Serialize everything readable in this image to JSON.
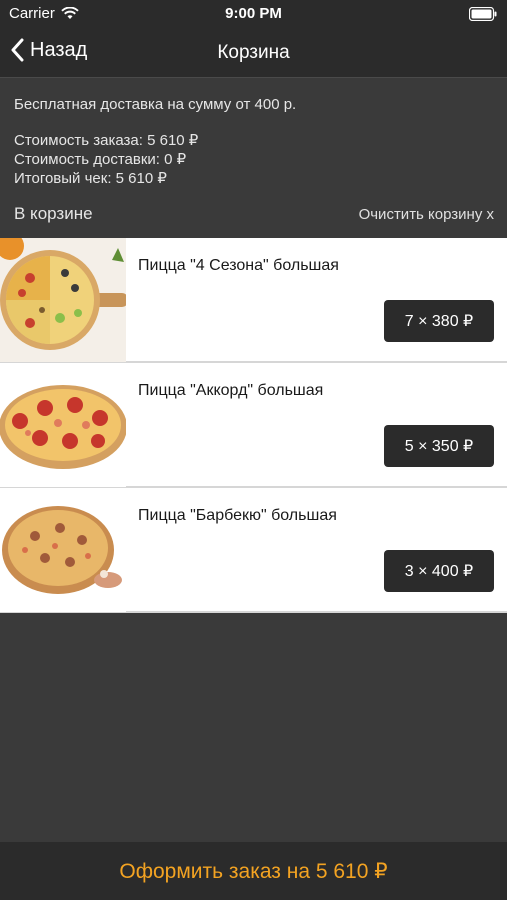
{
  "status_bar": {
    "carrier": "Carrier",
    "time": "9:00 PM"
  },
  "nav": {
    "back_label": "Назад",
    "title": "Корзина"
  },
  "info": {
    "free_delivery": "Бесплатная доставка на сумму от 400 р.",
    "order_cost": "Стоимость заказа: 5 610 ₽",
    "delivery_cost": "Стоимость доставки: 0 ₽",
    "total": "Итоговый чек: 5 610 ₽"
  },
  "cart": {
    "header": "В корзине",
    "clear_label": "Очистить корзину x",
    "items": [
      {
        "name": "Пицца \"4 Сезона\" большая",
        "qty_price": "7 × 380 ₽"
      },
      {
        "name": "Пицца \"Аккорд\" большая",
        "qty_price": "5 × 350 ₽"
      },
      {
        "name": "Пицца \"Барбекю\" большая",
        "qty_price": "3 × 400 ₽"
      }
    ]
  },
  "checkout": {
    "label": "Оформить заказ на 5 610 ₽"
  },
  "colors": {
    "accent": "#f3a322",
    "bar": "#2b2b2b",
    "background": "#3a3a3a"
  }
}
